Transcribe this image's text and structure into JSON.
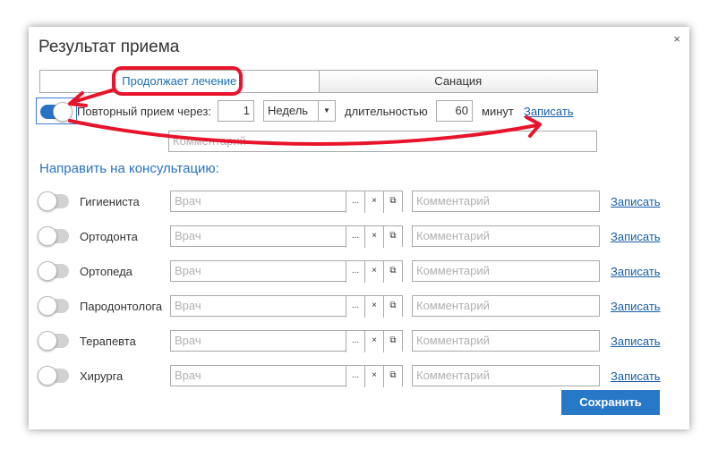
{
  "dialog": {
    "title": "Результат приема",
    "close_glyph": "×"
  },
  "tabs": [
    {
      "label": "Продолжает лечение",
      "active": true
    },
    {
      "label": "Санация",
      "active": false
    }
  ],
  "repeat": {
    "toggle_on": true,
    "label": "Повторный прием через:",
    "interval_value": "1",
    "unit_selected": "Недель",
    "duration_label": "длительностью",
    "duration_value": "60",
    "minutes_label": "минут",
    "book_link": "Записать",
    "comment_placeholder": "Комментарий"
  },
  "consult": {
    "title": "Направить на консультацию:",
    "doctor_placeholder": "Врач",
    "comment_placeholder": "Комментарий",
    "browse_glyph": "...",
    "clear_glyph": "×",
    "open_glyph": "⧉",
    "book_link": "Записать",
    "rows": [
      {
        "label": "Гигиениста"
      },
      {
        "label": "Ортодонта"
      },
      {
        "label": "Ортопеда"
      },
      {
        "label": "Пародонтолога"
      },
      {
        "label": "Терапевта"
      },
      {
        "label": "Хирурга"
      }
    ]
  },
  "save_button": "Сохранить",
  "colors": {
    "accent": "#2a72c4",
    "annotation": "#e8142c"
  }
}
